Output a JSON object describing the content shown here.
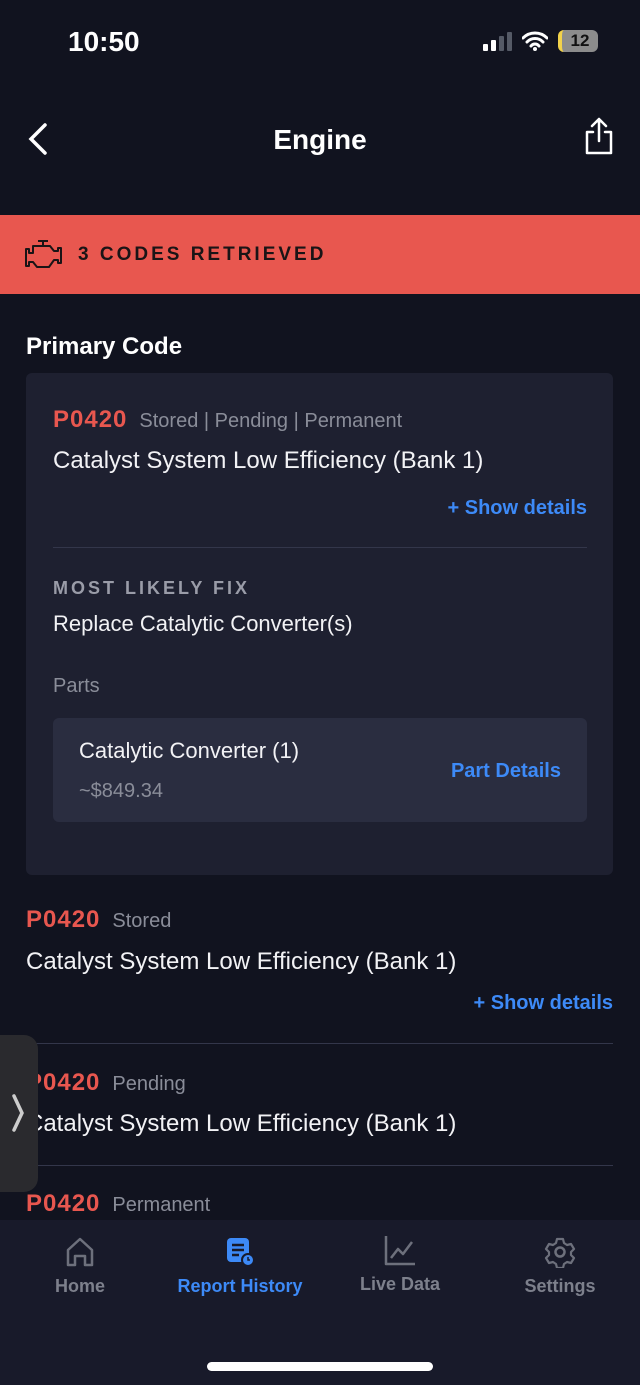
{
  "status_bar": {
    "time": "10:50",
    "battery": "12"
  },
  "header": {
    "title": "Engine",
    "back_icon": "chevron-left-icon",
    "share_icon": "share-icon"
  },
  "banner": {
    "text": "3 CODES RETRIEVED",
    "icon": "check-engine-icon",
    "color": "#e8574f"
  },
  "primary": {
    "section_title": "Primary Code",
    "code": "P0420",
    "status": "Stored | Pending | Permanent",
    "description": "Catalyst System Low Efficiency (Bank 1)",
    "show_details": "+ Show details",
    "fix_heading": "MOST LIKELY FIX",
    "fix": "Replace Catalytic Converter(s)",
    "parts_label": "Parts",
    "part": {
      "name": "Catalytic Converter (1)",
      "price": "~$849.34",
      "link": "Part Details"
    }
  },
  "codes": [
    {
      "code": "P0420",
      "status": "Stored",
      "description": "Catalyst System Low Efficiency (Bank 1)",
      "show_details": "+ Show details"
    },
    {
      "code": "P0420",
      "status": "Pending",
      "description": "Catalyst System Low Efficiency (Bank 1)"
    },
    {
      "code": "P0420",
      "status": "Permanent"
    }
  ],
  "tabs": [
    {
      "label": "Home",
      "icon": "home-icon"
    },
    {
      "label": "Report History",
      "icon": "report-history-icon",
      "active": true
    },
    {
      "label": "Live Data",
      "icon": "chart-line-icon"
    },
    {
      "label": "Settings",
      "icon": "gear-icon"
    }
  ],
  "colors": {
    "accent": "#3d8af7",
    "code_red": "#e8574f",
    "background": "#11131f"
  }
}
